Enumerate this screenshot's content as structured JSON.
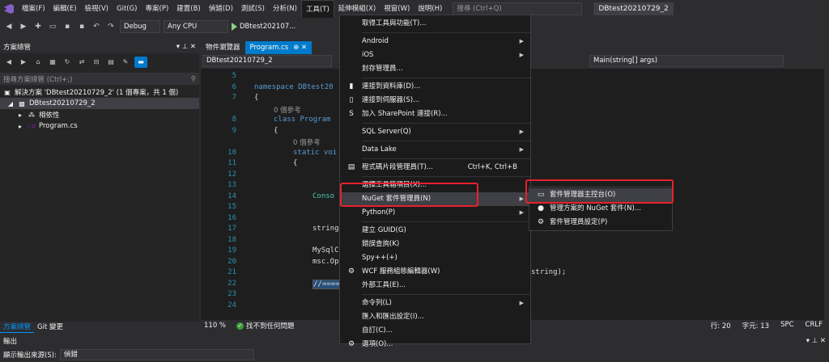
{
  "menubar": {
    "items": [
      "檔案(F)",
      "編輯(E)",
      "檢視(V)",
      "Git(G)",
      "專案(P)",
      "建置(B)",
      "偵錯(D)",
      "測試(S)",
      "分析(N)",
      "工具(T)",
      "延伸模組(X)",
      "視窗(W)",
      "說明(H)"
    ],
    "search_placeholder": "搜尋 (Ctrl+Q)",
    "solution_title": "DBtest20210729_2"
  },
  "toolbar": {
    "config": "Debug",
    "platform": "Any CPU",
    "run_label": "DBtest202107..."
  },
  "solution_explorer": {
    "title": "方案總管",
    "search_placeholder": "搜尋方案總管 (Ctrl+;)",
    "solution_label": "解決方案 'DBtest20210729_2' (1 個專案，共 1 個)",
    "project": "DBtest20210729_2",
    "dependencies": "相依性",
    "program_file": "Program.cs",
    "tabs": [
      "方案總管",
      "Git 變更"
    ]
  },
  "editor": {
    "tabs": [
      "物件瀏覽器",
      "Program.cs"
    ],
    "nav_left": "DBtest20210729_2",
    "nav_right": "Main(string[] args)",
    "lines": [
      {
        "n": "5",
        "text": ""
      },
      {
        "n": "6",
        "text": "namespace DBtest20"
      },
      {
        "n": "7",
        "text": "{"
      },
      {
        "n": "",
        "text": "0 個參考"
      },
      {
        "n": "8",
        "text": "class Program"
      },
      {
        "n": "9",
        "text": "{"
      },
      {
        "n": "",
        "text": "0 個參考"
      },
      {
        "n": "10",
        "text": "static voi"
      },
      {
        "n": "11",
        "text": "{"
      },
      {
        "n": "12",
        "text": ""
      },
      {
        "n": "13",
        "text": ""
      },
      {
        "n": "14",
        "text": "Conso"
      },
      {
        "n": "15",
        "text": ""
      },
      {
        "n": "16",
        "text": ""
      },
      {
        "n": "17",
        "text": "string"
      },
      {
        "n": "18",
        "text": ""
      },
      {
        "n": "19",
        "text": "MySqlC"
      },
      {
        "n": "20",
        "text": "msc.Op"
      },
      {
        "n": "21",
        "text": ""
      },
      {
        "n": "22",
        "text": "//===="
      },
      {
        "n": "23",
        "text": ""
      },
      {
        "n": "24",
        "text": ""
      }
    ],
    "line19_tail": "string);",
    "zoom": "110 %",
    "status_ok": "找不到任何問題",
    "row": "行: 20",
    "col": "字元: 13",
    "spc": "SPC",
    "crlf": "CRLF"
  },
  "output": {
    "title": "輸出",
    "source_label": "顯示輸出來源(S):",
    "source_value": "偵錯"
  },
  "tools_menu": {
    "items": [
      {
        "label": "取得工具與功能(T)...",
        "icon": ""
      },
      {
        "sep": true
      },
      {
        "label": "Android",
        "arrow": true
      },
      {
        "label": "iOS",
        "arrow": true
      },
      {
        "label": "封存管理員..."
      },
      {
        "sep": true
      },
      {
        "label": "連接到資料庫(D)...",
        "icon": "db-icon"
      },
      {
        "label": "連接到伺服器(S)...",
        "icon": "server-icon"
      },
      {
        "label": "加入 SharePoint 連接(R)...",
        "icon": "sharepoint-icon"
      },
      {
        "sep": true
      },
      {
        "label": "SQL Server(Q)",
        "arrow": true
      },
      {
        "sep": true
      },
      {
        "label": "Data Lake",
        "arrow": true
      },
      {
        "sep": true
      },
      {
        "label": "程式碼片段管理員(T)...",
        "icon": "snippet-icon",
        "shortcut": "Ctrl+K, Ctrl+B"
      },
      {
        "sep": true
      },
      {
        "label": "選擇工具箱項目(X)..."
      },
      {
        "label": "NuGet 套件管理員(N)",
        "arrow": true,
        "hover": true
      },
      {
        "label": "Python(P)",
        "arrow": true
      },
      {
        "sep": true
      },
      {
        "label": "建立 GUID(G)"
      },
      {
        "label": "錯誤查詢(K)"
      },
      {
        "label": "Spy++(+)"
      },
      {
        "label": "WCF 服務組態編輯器(W)",
        "icon": "gear-icon"
      },
      {
        "label": "外部工具(E)..."
      },
      {
        "sep": true
      },
      {
        "label": "命令列(L)",
        "arrow": true
      },
      {
        "label": "匯入和匯出設定(I)..."
      },
      {
        "label": "自訂(C)..."
      },
      {
        "label": "選項(O)...",
        "icon": "gear-icon"
      }
    ]
  },
  "nuget_submenu": {
    "items": [
      {
        "label": "套件管理器主控台(O)",
        "icon": "console-icon",
        "hover": true
      },
      {
        "label": "管理方案的 NuGet 套件(N)...",
        "icon": "nuget-icon"
      },
      {
        "label": "套件管理員設定(P)",
        "icon": "gear-icon"
      }
    ]
  },
  "colors": {
    "accent": "#007acc",
    "highlight": "#e8212b"
  }
}
